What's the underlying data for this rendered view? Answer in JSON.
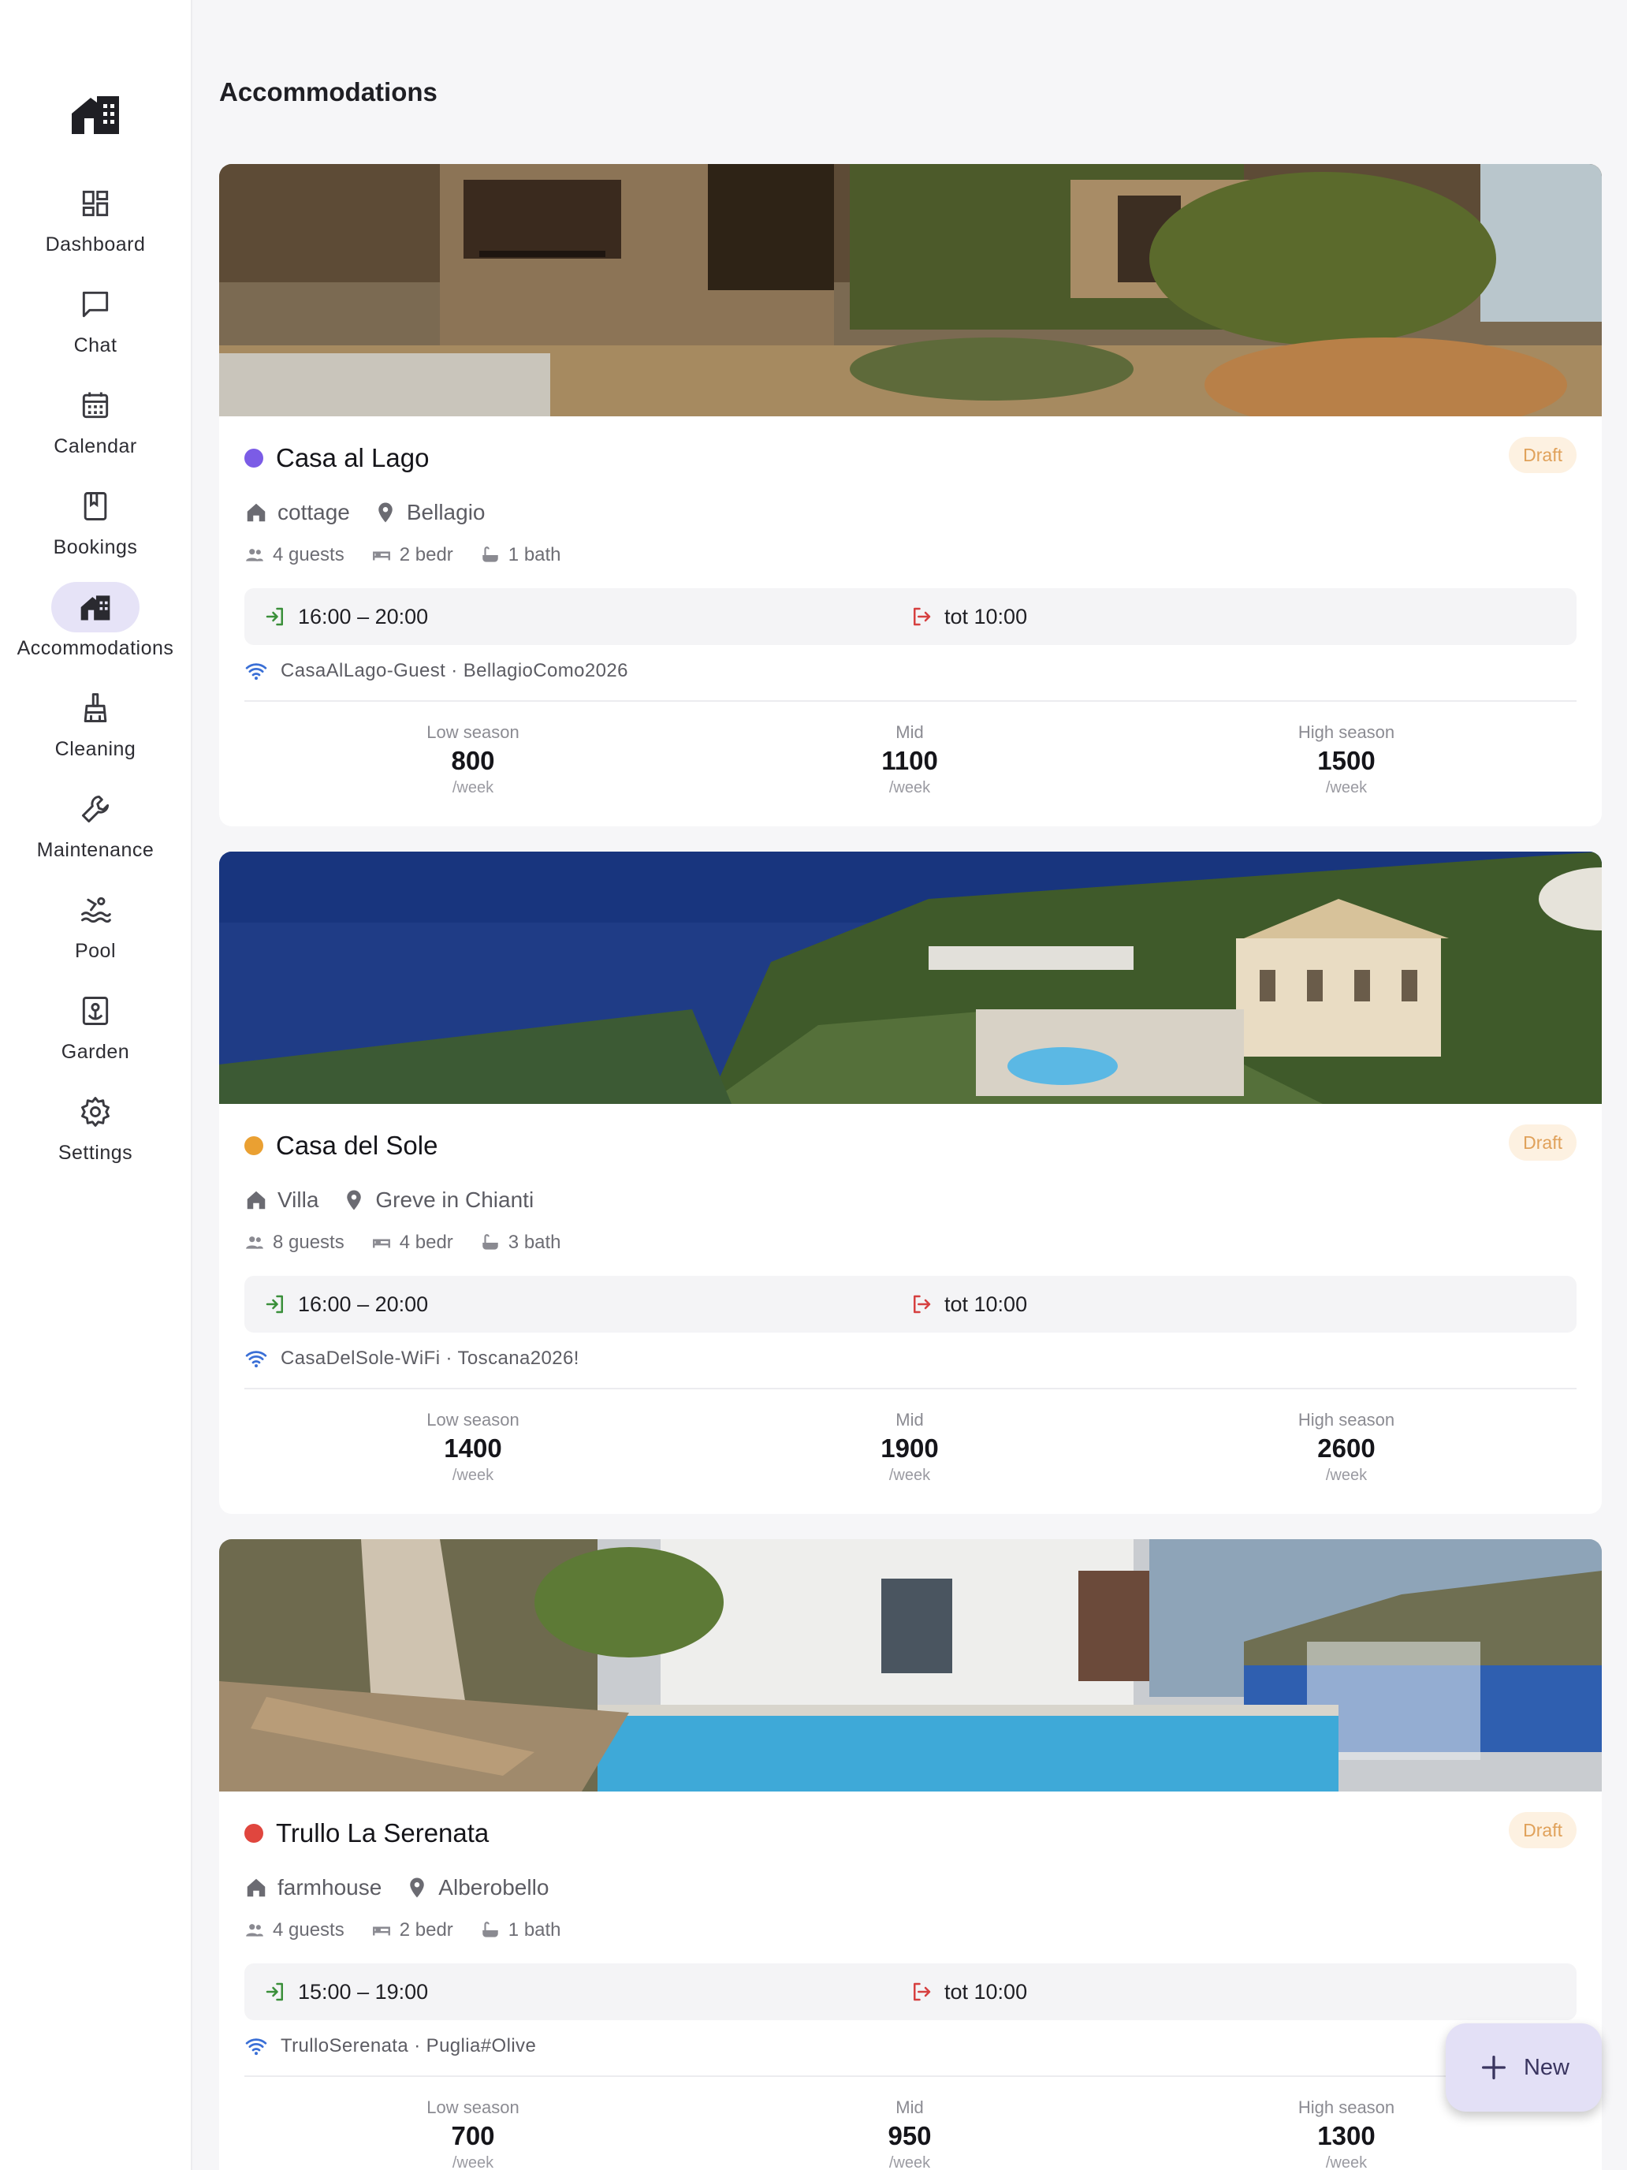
{
  "sidebar": {
    "items": [
      {
        "label": "Dashboard",
        "icon": "dashboard-icon"
      },
      {
        "label": "Chat",
        "icon": "chat-icon"
      },
      {
        "label": "Calendar",
        "icon": "calendar-icon"
      },
      {
        "label": "Bookings",
        "icon": "book-icon"
      },
      {
        "label": "Accommodations",
        "icon": "house-icon",
        "active": true
      },
      {
        "label": "Cleaning",
        "icon": "broom-icon"
      },
      {
        "label": "Maintenance",
        "icon": "wrench-icon"
      },
      {
        "label": "Pool",
        "icon": "pool-icon"
      },
      {
        "label": "Garden",
        "icon": "garden-icon"
      },
      {
        "label": "Settings",
        "icon": "gear-icon"
      }
    ]
  },
  "page": {
    "title": "Accommodations"
  },
  "accommodations": [
    {
      "name": "Casa al Lago",
      "status_color": "#7b5ce6",
      "badge": "Draft",
      "type": "cottage",
      "location": "Bellagio",
      "guests": "4 guests",
      "bedrooms": "2 bedr",
      "baths": "1 bath",
      "checkin": "16:00 – 20:00",
      "checkout": "tot 10:00",
      "wifi": "CasaAlLago-Guest · BellagioComo2026",
      "prices": [
        {
          "label": "Low season",
          "value": "800",
          "unit": "/week"
        },
        {
          "label": "Mid",
          "value": "1100",
          "unit": "/week"
        },
        {
          "label": "High season",
          "value": "1500",
          "unit": "/week"
        }
      ]
    },
    {
      "name": "Casa del Sole",
      "status_color": "#eaa032",
      "badge": "Draft",
      "type": "Villa",
      "location": "Greve in Chianti",
      "guests": "8 guests",
      "bedrooms": "4 bedr",
      "baths": "3 bath",
      "checkin": "16:00 – 20:00",
      "checkout": "tot 10:00",
      "wifi": "CasaDelSole-WiFi · Toscana2026!",
      "prices": [
        {
          "label": "Low season",
          "value": "1400",
          "unit": "/week"
        },
        {
          "label": "Mid",
          "value": "1900",
          "unit": "/week"
        },
        {
          "label": "High season",
          "value": "2600",
          "unit": "/week"
        }
      ]
    },
    {
      "name": "Trullo La Serenata",
      "status_color": "#e0463e",
      "badge": "Draft",
      "type": "farmhouse",
      "location": "Alberobello",
      "guests": "4 guests",
      "bedrooms": "2 bedr",
      "baths": "1 bath",
      "checkin": "15:00 – 19:00",
      "checkout": "tot 10:00",
      "wifi": "TrulloSerenata · Puglia#Olive",
      "prices": [
        {
          "label": "Low season",
          "value": "700",
          "unit": "/week"
        },
        {
          "label": "Mid",
          "value": "950",
          "unit": "/week"
        },
        {
          "label": "High season",
          "value": "1300",
          "unit": "/week"
        }
      ]
    }
  ],
  "fab": {
    "label": "New",
    "icon": "plus-icon"
  },
  "colors": {
    "accent": "#e6e3f7",
    "draft": "#e0a15a",
    "checkin": "#3a8f3a",
    "checkout": "#d64040",
    "wifi": "#3a6fd6"
  }
}
